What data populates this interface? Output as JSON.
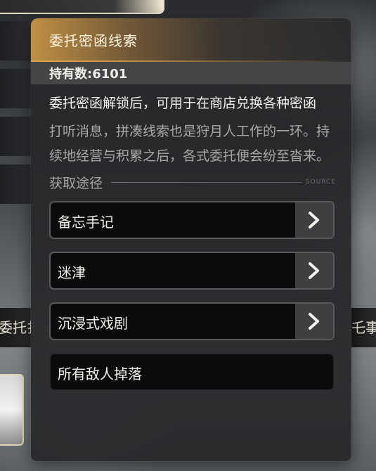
{
  "background": {
    "banner_left_text": "委托扌",
    "banner_right_text": "乇事"
  },
  "panel": {
    "title": "委托密函线索",
    "holding": "持有数:6101",
    "description": "委托密函解锁后，可用于在商店兑换各种密函",
    "flavor": "打听消息，拼凑线索也是狩月人工作的一环。持续地经营与积累之后，各式委托便会纷至沓来。",
    "sources_label": "获取途径",
    "sources_deco": "SOURCE",
    "routes": [
      {
        "label": "备忘手记",
        "has_arrow": true
      },
      {
        "label": "迷津",
        "has_arrow": true
      },
      {
        "label": "沉浸式戏剧",
        "has_arrow": true
      },
      {
        "label": "所有敌人掉落",
        "has_arrow": false
      }
    ]
  },
  "colors": {
    "header_accent": "#e0a54b",
    "route_bg": "#0b0b0c",
    "arrow_bg": "#3f3f42"
  },
  "icons": {
    "route_arrow": "chevron-right-icon"
  }
}
